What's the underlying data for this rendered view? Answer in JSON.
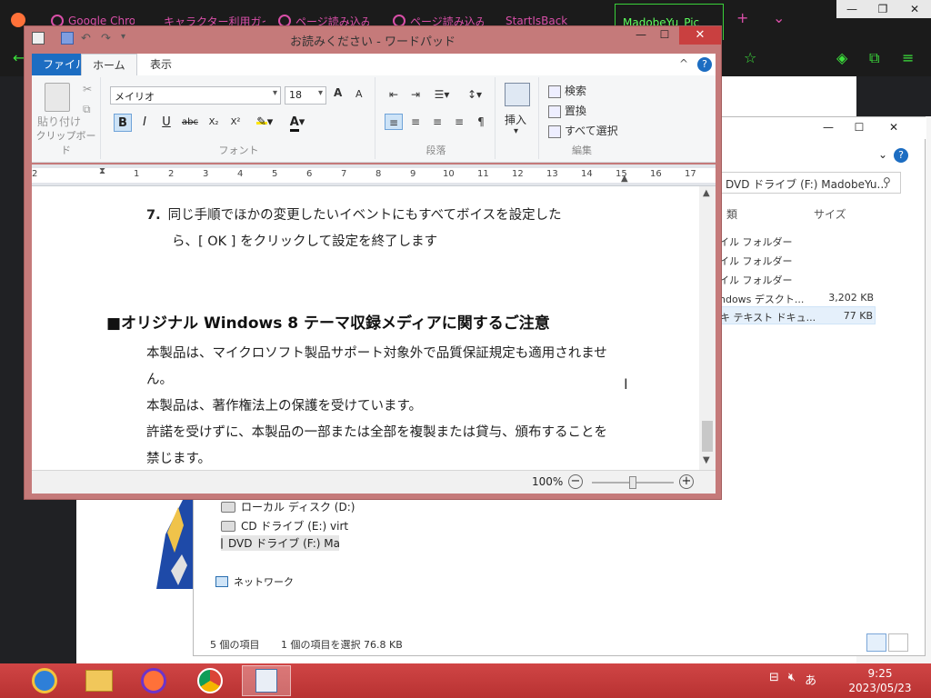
{
  "browser": {
    "tabs": [
      {
        "label": "Google Chrom"
      },
      {
        "label": "キャラクター利用ガイ"
      },
      {
        "label": "ページ読み込み"
      },
      {
        "label": "ページ読み込み"
      },
      {
        "label": "StartIsBack"
      },
      {
        "label": "MadobeYu_Pic"
      }
    ],
    "new_tab": "+",
    "tab_menu": "⌄",
    "win_min": "—",
    "win_max": "❐",
    "win_close": "✕"
  },
  "explorer": {
    "win_min": "—",
    "win_max": "☐",
    "win_close": "✕",
    "chevron": "⌄",
    "help": "?",
    "search_text": "DVD ドライブ (F:) MadobeYu...",
    "header_type": "類",
    "header_size": "サイズ",
    "rows": [
      {
        "type": "イル フォルダー",
        "size": ""
      },
      {
        "type": "イル フォルダー",
        "size": ""
      },
      {
        "type": "イル フォルダー",
        "size": ""
      },
      {
        "type": "ndows デスクト...",
        "size": "3,202 KB"
      },
      {
        "type": "キ テキスト ドキュ...",
        "size": "77 KB"
      }
    ],
    "nav": [
      {
        "label": "ローカル ディスク (D:)"
      },
      {
        "label": "CD ドライブ (E:) virt"
      },
      {
        "label": "DVD ドライブ (F:) Ma"
      },
      {
        "label": "ネットワーク"
      }
    ],
    "status_count": "5 個の項目",
    "status_selected": "1 個の項目を選択  76.8 KB"
  },
  "wordpad": {
    "title": "お読みください - ワードパッド",
    "win_min": "—",
    "win_max": "☐",
    "win_close": "✕",
    "tabs": {
      "file": "ファイル",
      "home": "ホーム",
      "view": "表示"
    },
    "collapse": "^",
    "help": "?",
    "clipboard": {
      "paste": "貼り付け",
      "label": "クリップボード"
    },
    "font": {
      "family": "メイリオ",
      "size": "18",
      "grow": "A",
      "shrink": "A",
      "bold": "B",
      "italic": "I",
      "underline": "U",
      "strike": "abc",
      "sub": "X₂",
      "sup": "X²",
      "color": "A",
      "label": "フォント"
    },
    "paragraph": {
      "label": "段落"
    },
    "insert": {
      "label": "挿入"
    },
    "edit": {
      "find": "検索",
      "replace": "置換",
      "select_all": "すべて選択",
      "label": "編集"
    },
    "ruler_numbers": [
      "2",
      "1",
      "1",
      "2",
      "3",
      "4",
      "5",
      "6",
      "7",
      "8",
      "9",
      "10",
      "11",
      "12",
      "13",
      "14",
      "15",
      "16",
      "17"
    ],
    "doc": {
      "step_num": "7.",
      "step_line1": "同じ手順でほかの変更したいイベントにもすべてボイスを設定した",
      "step_line2": "ら、[ OK ] をクリックして設定を終了します",
      "heading": "■オリジナル Windows 8 テーマ収録メディアに関するご注意",
      "p1_line1": "本製品は、マイクロソフト製品サポート対象外で品質保証規定も適用されませ",
      "p1_line2": "ん。",
      "p2": "本製品は、著作権法上の保護を受けています。",
      "p3_line1": "許諾を受けずに、本製品の一部または全部を複製または貸与、頒布することを",
      "p3_line2": "禁じます。"
    },
    "zoom": "100%",
    "zoom_out": "−",
    "zoom_in": "+",
    "zoom_level": 0.5
  },
  "taskbar": {
    "time": "9:25",
    "date": "2023/05/23",
    "ime": "あ"
  }
}
